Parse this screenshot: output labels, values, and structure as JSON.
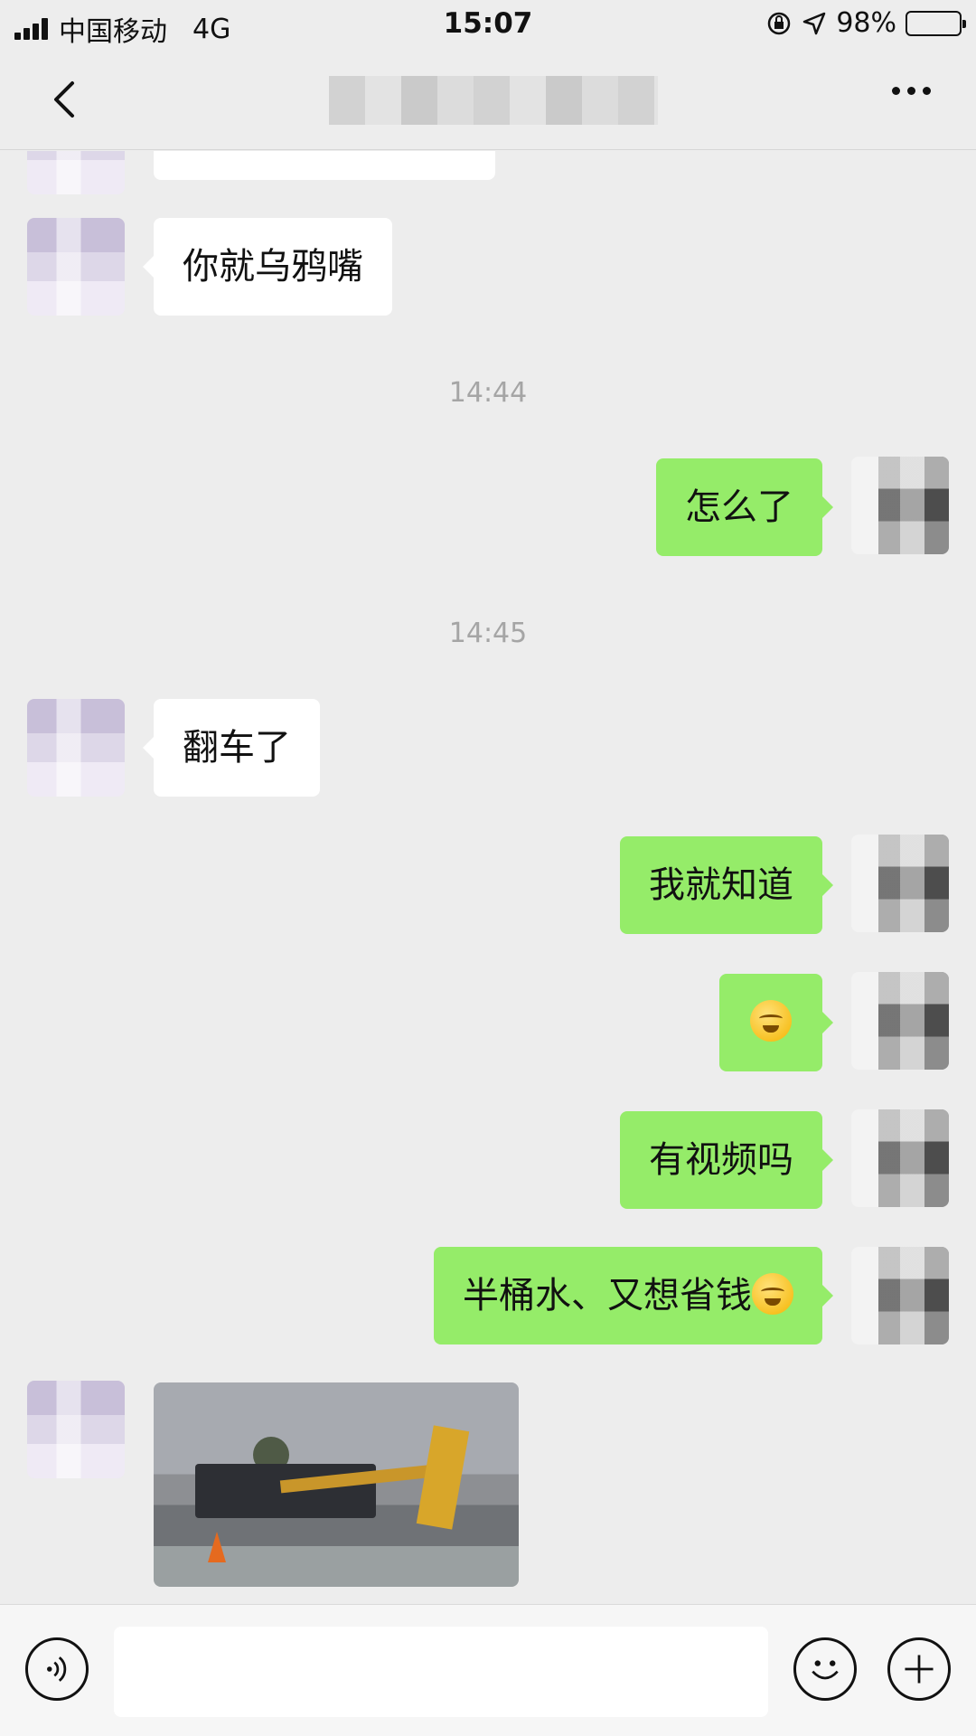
{
  "status_bar": {
    "carrier": "中国移动",
    "network": "4G",
    "time": "15:07",
    "battery_text": "98%",
    "battery_level": 0.98,
    "icons": [
      "signal-icon",
      "orientation-lock-icon",
      "location-icon",
      "battery-icon"
    ]
  },
  "nav": {
    "back_icon": "chevron-left-icon",
    "more_icon": "more-dots-icon"
  },
  "messages": [
    {
      "side": "left",
      "text": "你就乌鸦嘴"
    },
    {
      "type": "time",
      "text": "14:44"
    },
    {
      "side": "right",
      "text": "怎么了"
    },
    {
      "type": "time",
      "text": "14:45"
    },
    {
      "side": "left",
      "text": "翻车了"
    },
    {
      "side": "right",
      "text": "我就知道"
    },
    {
      "side": "right",
      "emoji": "crying-laughing-emoji"
    },
    {
      "side": "right",
      "text": "有视频吗"
    },
    {
      "side": "right",
      "text": "半桶水、又想省钱",
      "emoji": "sweat-smile-emoji"
    },
    {
      "side": "left",
      "type": "image",
      "image": "overturned-crane-truck-photo"
    }
  ],
  "input_bar": {
    "voice_icon": "voice-icon",
    "emoji_icon": "smiley-icon",
    "plus_icon": "plus-icon"
  },
  "colors": {
    "background": "#ededed",
    "outgoing_bubble": "#95ec69",
    "incoming_bubble": "#ffffff",
    "timestamp": "#a5a5a5"
  }
}
